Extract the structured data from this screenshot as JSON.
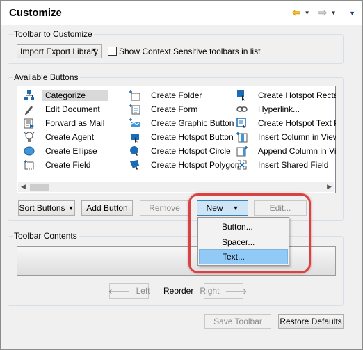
{
  "window": {
    "title": "Customize"
  },
  "nav": {
    "back_icon": "arrow-left-icon",
    "forward_icon": "arrow-right-icon",
    "dropdown_glyph": "▼"
  },
  "icons": {
    "back_arrow": "⇦",
    "forward_arrow": "⇨",
    "combo_arrow": "▼",
    "scroll_left": "◀",
    "scroll_right": "▶",
    "left_arrow": "🡐",
    "right_arrow": "🡒"
  },
  "toolbar_group": {
    "legend": "Toolbar to Customize",
    "selected_toolbar": "Import Export Library",
    "checkbox_label": "Show Context Sensitive toolbars in list",
    "checkbox_checked": false
  },
  "available_group": {
    "legend": "Available Buttons",
    "columns": [
      [
        {
          "label": "Categorize",
          "icon": "categorize-icon",
          "selected": true
        },
        {
          "label": "Edit Document",
          "icon": "pencil-icon"
        },
        {
          "label": "Forward as Mail",
          "icon": "forward-mail-icon"
        },
        {
          "label": "Create Agent",
          "icon": "agent-bulb-icon"
        },
        {
          "label": "Create Ellipse",
          "icon": "ellipse-icon"
        },
        {
          "label": "Create Field",
          "icon": "field-icon"
        }
      ],
      [
        {
          "label": "Create Folder",
          "icon": "folder-icon"
        },
        {
          "label": "Create Form",
          "icon": "form-icon"
        },
        {
          "label": "Create Graphic Button",
          "icon": "graphic-button-icon"
        },
        {
          "label": "Create Hotspot Button",
          "icon": "hotspot-button-icon"
        },
        {
          "label": "Create Hotspot Circle",
          "icon": "hotspot-circle-icon"
        },
        {
          "label": "Create Hotspot Polygon",
          "icon": "hotspot-polygon-icon"
        }
      ],
      [
        {
          "label": "Create Hotspot Rectang",
          "icon": "hotspot-rectangle-icon"
        },
        {
          "label": "Hyperlink...",
          "icon": "hyperlink-icon"
        },
        {
          "label": "Create Hotspot Text Pop",
          "icon": "hotspot-text-icon"
        },
        {
          "label": "Insert Column in View",
          "icon": "insert-column-icon"
        },
        {
          "label": "Append Column in View",
          "icon": "append-column-icon"
        },
        {
          "label": "Insert Shared Field",
          "icon": "shared-field-icon"
        }
      ]
    ]
  },
  "buttons": {
    "sort": "Sort Buttons",
    "add": "Add Button",
    "remove": "Remove",
    "new": "New",
    "edit": "Edit..."
  },
  "new_menu": {
    "items": [
      {
        "label": "Button...",
        "hover": false
      },
      {
        "label": "Spacer...",
        "hover": false
      },
      {
        "label": "Text...",
        "hover": true
      }
    ]
  },
  "contents_group": {
    "legend": "Toolbar Contents"
  },
  "reorder": {
    "left": "Left",
    "label": "Reorder",
    "right": "Right"
  },
  "footer": {
    "save": "Save Toolbar",
    "restore": "Restore Defaults"
  },
  "colors": {
    "highlight": "#d94242",
    "menu_hover": "#91c9f7",
    "selection": "#d9d9d9"
  }
}
